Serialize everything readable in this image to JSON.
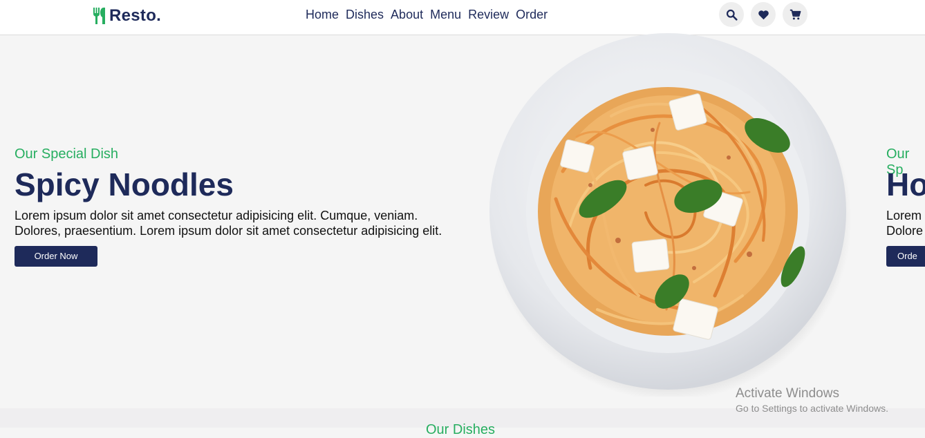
{
  "brand": {
    "name": "Resto.",
    "accent": "#27ae60",
    "primary": "#1e2a5a"
  },
  "nav": {
    "items": [
      "Home",
      "Dishes",
      "About",
      "Menu",
      "Review",
      "Order"
    ]
  },
  "header_icons": [
    "search-icon",
    "heart-icon",
    "cart-icon"
  ],
  "slide": {
    "subtitle": "Our Special Dish",
    "title": "Spicy Noodles",
    "desc_line1": "Lorem ipsum dolor sit amet consectetur adipisicing elit. Cumque, veniam.",
    "desc_line2": "Dolores, praesentium. Lorem ipsum dolor sit amet consectetur adipisicing elit.",
    "button": "Order Now"
  },
  "next_slide_peek": {
    "subtitle": "Our Sp",
    "title": "Ho",
    "desc_line1": "Lorem",
    "desc_line2": "Dolore",
    "button": "Orde"
  },
  "next_section": {
    "heading": "Our Dishes"
  },
  "watermark": {
    "title": "Activate Windows",
    "subtitle": "Go to Settings to activate Windows."
  }
}
